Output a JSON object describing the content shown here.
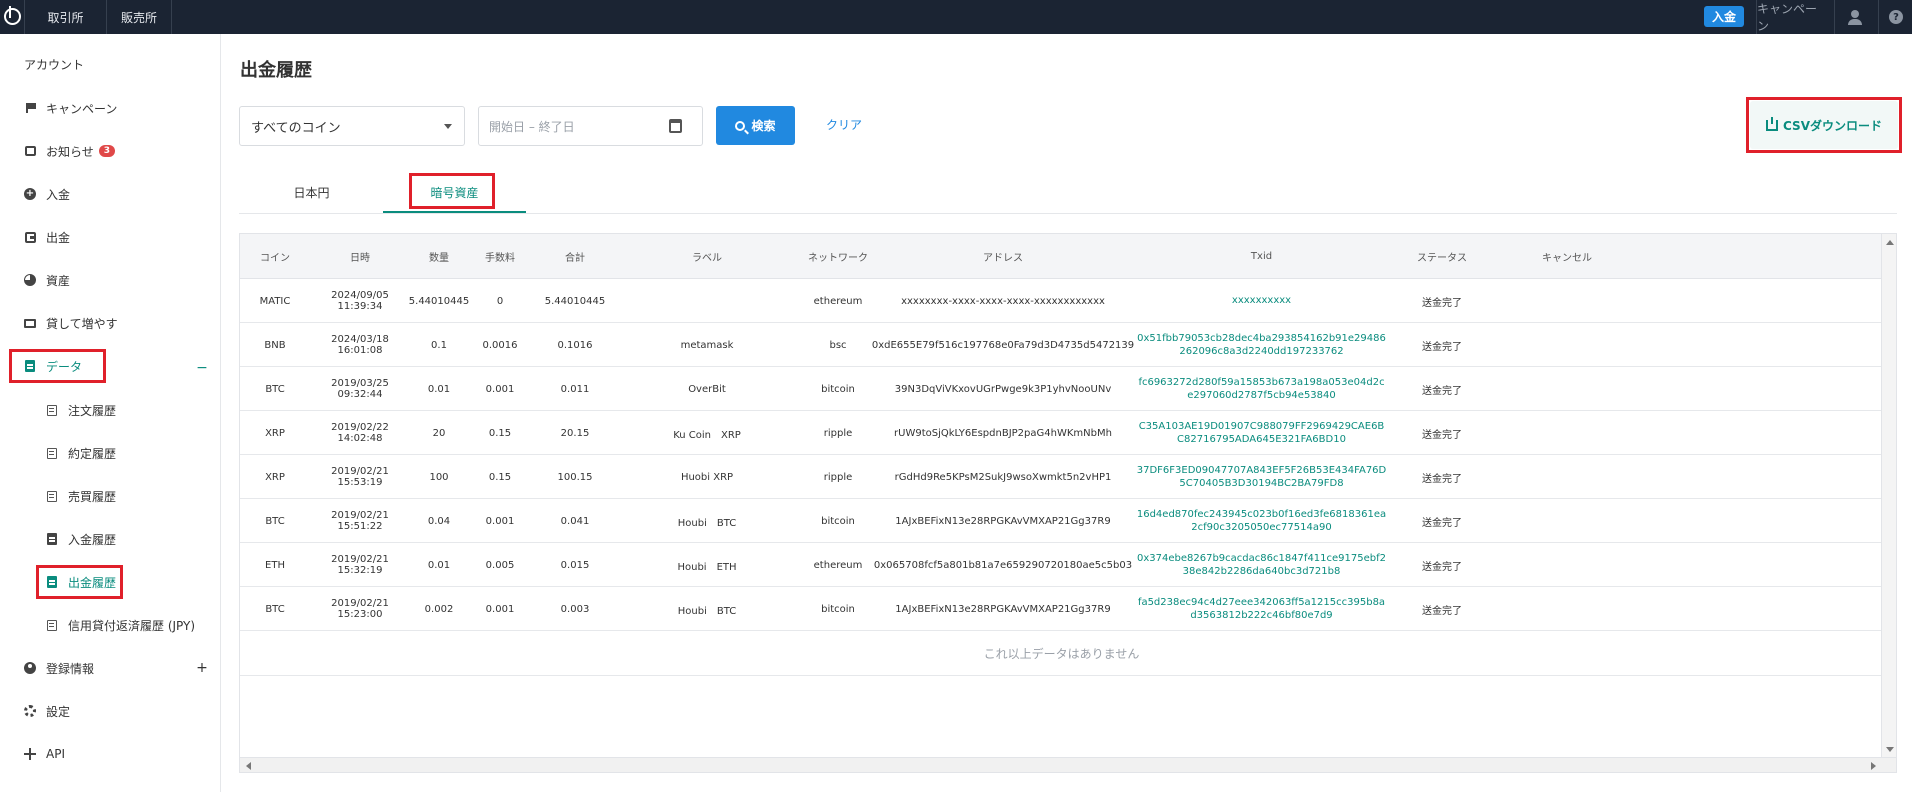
{
  "topbar": {
    "nav": [
      "取引所",
      "販売所"
    ],
    "deposit_label": "入金",
    "campaign_label": "キャンペーン",
    "help_label": "?"
  },
  "sidebar": {
    "title": "アカウント",
    "items": [
      {
        "label": "キャンペーン",
        "icon": "flag-icon"
      },
      {
        "label": "お知らせ",
        "icon": "chat-icon",
        "badge": "3"
      },
      {
        "label": "入金",
        "icon": "plus-circle-icon"
      },
      {
        "label": "出金",
        "icon": "wallet-icon"
      },
      {
        "label": "資産",
        "icon": "pie-chart-icon"
      },
      {
        "label": "貸して増やす",
        "icon": "lending-icon"
      },
      {
        "label": "データ",
        "icon": "clipboard-icon",
        "expanded_symbol": "−"
      }
    ],
    "subitems": [
      {
        "label": "注文履歴",
        "icon": "document-icon"
      },
      {
        "label": "約定履歴",
        "icon": "document-icon"
      },
      {
        "label": "売買履歴",
        "icon": "document-icon"
      },
      {
        "label": "入金履歴",
        "icon": "clipboard-icon"
      },
      {
        "label": "出金履歴",
        "icon": "clipboard-icon"
      },
      {
        "label": "信用貸付返済履歴 (JPY)",
        "icon": "document-icon"
      }
    ],
    "bottom_items": [
      {
        "label": "登録情報",
        "icon": "user-icon",
        "expand_symbol": "+"
      },
      {
        "label": "設定",
        "icon": "gear-icon"
      },
      {
        "label": "API",
        "icon": "api-icon"
      }
    ]
  },
  "main": {
    "title": "出金履歴",
    "coin_select_value": "すべてのコイン",
    "date_placeholder": "開始日 – 終了日",
    "search_label": "検索",
    "clear_label": "クリア",
    "csv_label": "CSVダウンロード",
    "tabs": [
      {
        "label": "日本円",
        "active": false
      },
      {
        "label": "暗号資産",
        "active": true
      }
    ]
  },
  "table": {
    "columns": [
      "コイン",
      "日時",
      "数量",
      "手数料",
      "合計",
      "ラベル",
      "ネットワーク",
      "アドレス",
      "Txid",
      "ステータス",
      "キャンセル"
    ],
    "rows": [
      {
        "coin": "MATIC",
        "datetime": "2024/09/05 11:39:34",
        "amount": "5.44010445",
        "fee": "0",
        "total": "5.44010445",
        "label": "",
        "network": "ethereum",
        "address": "xxxxxxxx-xxxx-xxxx-xxxx-xxxxxxxxxxxx",
        "txid": "xxxxxxxxxx",
        "status": "送金完了",
        "cancel": ""
      },
      {
        "coin": "BNB",
        "datetime": "2024/03/18 16:01:08",
        "amount": "0.1",
        "fee": "0.0016",
        "total": "0.1016",
        "label": "metamask",
        "network": "bsc",
        "address": "0xdE655E79f516c197768e0Fa79d3D4735d5472139",
        "txid": "0x51fbb79053cb28dec4ba293854162b91e29486262096c8a3d2240dd197233762",
        "status": "送金完了",
        "cancel": ""
      },
      {
        "coin": "BTC",
        "datetime": "2019/03/25 09:32:44",
        "amount": "0.01",
        "fee": "0.001",
        "total": "0.011",
        "label": "OverBit",
        "network": "bitcoin",
        "address": "39N3DqViVKxovUGrPwge9k3P1yhvNooUNv",
        "txid": "fc6963272d280f59a15853b673a198a053e04d2ce297060d2787f5cb94e53840",
        "status": "送金完了",
        "cancel": ""
      },
      {
        "coin": "XRP",
        "datetime": "2019/02/22 14:02:48",
        "amount": "20",
        "fee": "0.15",
        "total": "20.15",
        "label": "Ku Coin　XRP",
        "network": "ripple",
        "address": "rUW9toSjQkLY6EspdnBJP2paG4hWKmNbMh",
        "txid": "C35A103AE19D01907C988079FF2969429CAE6BC82716795ADA645E321FA6BD10",
        "status": "送金完了",
        "cancel": ""
      },
      {
        "coin": "XRP",
        "datetime": "2019/02/21 15:53:19",
        "amount": "100",
        "fee": "0.15",
        "total": "100.15",
        "label": "Huobi XRP",
        "network": "ripple",
        "address": "rGdHd9Re5KPsM2SukJ9wsoXwmkt5n2vHP1",
        "txid": "37DF6F3ED09047707A843EF5F26B53E434FA76D5C70405B3D30194BC2BA79FD8",
        "status": "送金完了",
        "cancel": ""
      },
      {
        "coin": "BTC",
        "datetime": "2019/02/21 15:51:22",
        "amount": "0.04",
        "fee": "0.001",
        "total": "0.041",
        "label": "Houbi　BTC",
        "network": "bitcoin",
        "address": "1AJxBEFixN13e28RPGKAvVMXAP21Gg37R9",
        "txid": "16d4ed870fec243945c023b0f16ed3fe6818361ea2cf90c3205050ec77514a90",
        "status": "送金完了",
        "cancel": ""
      },
      {
        "coin": "ETH",
        "datetime": "2019/02/21 15:32:19",
        "amount": "0.01",
        "fee": "0.005",
        "total": "0.015",
        "label": "Houbi　ETH",
        "network": "ethereum",
        "address": "0x065708fcf5a801b81a7e659290720180ae5c5b03",
        "txid": "0x374ebe8267b9cacdac86c1847f411ce9175ebf238e842b2286da640bc3d721b8",
        "status": "送金完了",
        "cancel": ""
      },
      {
        "coin": "BTC",
        "datetime": "2019/02/21 15:23:00",
        "amount": "0.002",
        "fee": "0.001",
        "total": "0.003",
        "label": "Houbi　BTC",
        "network": "bitcoin",
        "address": "1AJxBEFixN13e28RPGKAvVMXAP21Gg37R9",
        "txid": "fa5d238ec94c4d27eee342063ff5a1215cc395b8ad3563812b222c46bf80e7d9",
        "status": "送金完了",
        "cancel": ""
      }
    ],
    "no_more_text": "これ以上データはありません"
  },
  "colors": {
    "accent_teal": "#0a8c7e",
    "primary_blue": "#2189e0",
    "topbar_bg": "#1b2433",
    "highlight_red": "#e0202a"
  }
}
